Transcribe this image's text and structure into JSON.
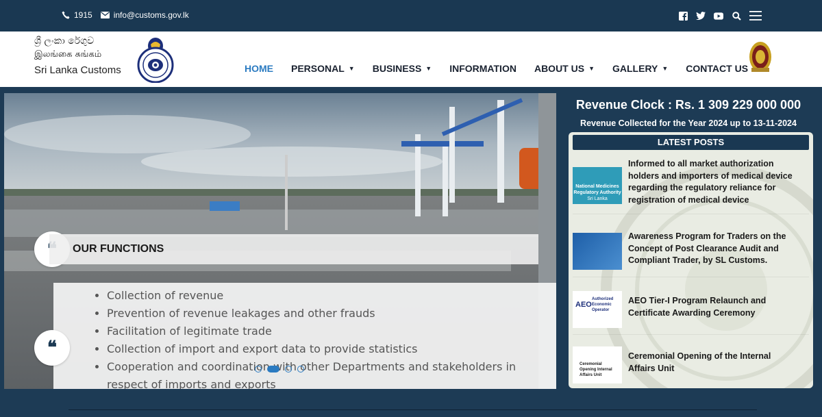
{
  "topbar": {
    "phone": "1915",
    "email": "info@customs.gov.lk",
    "social_icons": [
      "facebook-icon",
      "twitter-icon",
      "youtube-icon",
      "search-icon",
      "menu-icon"
    ]
  },
  "header": {
    "logo_line1": "ශ්‍රී ලංකා රේගුව",
    "logo_line2": "இலங்கை சுங்கம்",
    "logo_line3": "Sri Lanka Customs"
  },
  "nav": {
    "items": [
      {
        "label": "HOME",
        "active": true,
        "dropdown": false
      },
      {
        "label": "PERSONAL",
        "active": false,
        "dropdown": true
      },
      {
        "label": "BUSINESS",
        "active": false,
        "dropdown": true
      },
      {
        "label": "INFORMATION",
        "active": false,
        "dropdown": false
      },
      {
        "label": "ABOUT US",
        "active": false,
        "dropdown": true
      },
      {
        "label": "GALLERY",
        "active": false,
        "dropdown": true
      },
      {
        "label": "CONTACT US",
        "active": false,
        "dropdown": false
      }
    ]
  },
  "slider": {
    "title": "OUR FUNCTIONS",
    "functions": [
      "Collection of revenue",
      "Prevention of revenue leakages and other frauds",
      "Facilitation of legitimate trade",
      "Collection of import and export data to provide statistics",
      "Cooperation and coordination with other Departments and stakeholders in respect of imports and exports"
    ],
    "active_slide": 2,
    "slide_count": 4
  },
  "revenue": {
    "clock": "Revenue Clock : Rs. 1 309 229 000 000",
    "subtitle": "Revenue Collected for the Year 2024 up to 13-11-2024"
  },
  "posts": {
    "heading": "LATEST POSTS",
    "items": [
      {
        "text": "Informed to all market authorization holders and importers of medical device regarding the regulatory reliance for registration of medical device",
        "thumb_caption": "National Medicines Regulatory Authority",
        "thumb_sub": "Sri Lanka"
      },
      {
        "text": "Awareness Program for Traders on the Concept of Post Clearance Audit and Compliant Trader, by SL Customs.",
        "thumb_caption": "",
        "thumb_sub": ""
      },
      {
        "text": "AEO Tier-I Program Relaunch and Certificate Awarding Ceremony",
        "thumb_caption": "Authorized Economic Operator",
        "thumb_sub": "AEO"
      },
      {
        "text": "Ceremonial Opening of the Internal Affairs Unit",
        "thumb_caption": "Ceremonial Opening Internal Affairs Unit",
        "thumb_sub": ""
      }
    ]
  },
  "colors": {
    "navy": "#1a3852",
    "accent": "#2b7bc1",
    "page_bg": "#1d3b55"
  }
}
